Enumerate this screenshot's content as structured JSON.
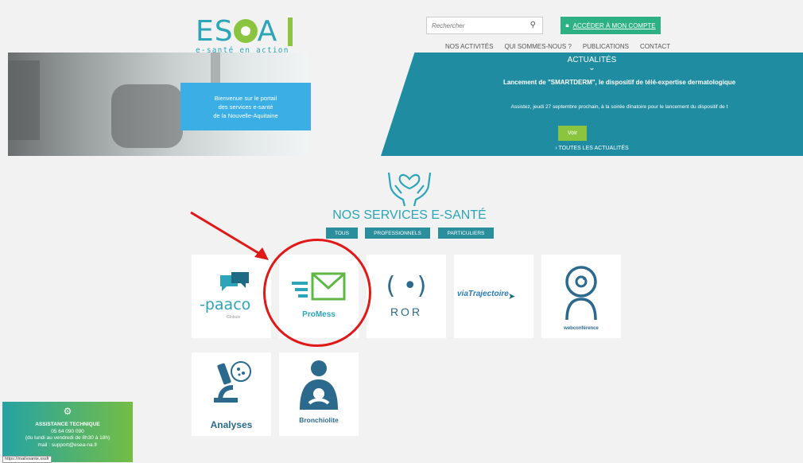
{
  "header": {
    "logo_text_left": "ES",
    "logo_text_right": "A",
    "logo_tagline": "e-santé en action",
    "search_placeholder": "Rechercher",
    "account_button": "ACCÉDER À MON COMPTE",
    "nav": [
      "NOS ACTIVITÉS",
      "QUI SOMMES-NOUS ?",
      "PUBLICATIONS",
      "CONTACT"
    ]
  },
  "hero": {
    "welcome_lines": [
      "Bienvenue sur le portail",
      "des services e-santé",
      "de la Nouvelle-Aquitaine"
    ],
    "news": {
      "section_title": "ACTUALITÉS",
      "headline": "Lancement de \"SMARTDERM\", le dispositif de télé-expertise dermatologique",
      "text": "Assistez, jeudi 27 septembre prochain, à la soirée dînatoire pour le lancement du dispositif de t",
      "voir_button": "Voir",
      "all_news_link": "TOUTES LES ACTUALITÉS"
    }
  },
  "services": {
    "title": "NOS SERVICES E-SANTÉ",
    "filters": [
      "TOUS",
      "PROFESSIONNELS",
      "PARTICULIERS"
    ],
    "cards": [
      {
        "name": "paaco",
        "label": "-paaco",
        "sublabel": "Globule"
      },
      {
        "name": "promess",
        "label": "ProMess"
      },
      {
        "name": "ror",
        "label": "ROR"
      },
      {
        "name": "viatrajectoire",
        "label": "viaTrajectoire"
      },
      {
        "name": "webconference",
        "label": "webconférence"
      },
      {
        "name": "analyses",
        "label": "Analyses"
      },
      {
        "name": "bronchiolite",
        "label": "Bronchiolite"
      }
    ]
  },
  "assistance": {
    "title": "ASSISTANCE TECHNIQUE",
    "phone": "05 64 090 090",
    "hours": "(du lundi au vendredi de 8h30 à 18h)",
    "mail": "mail : support@esea-na.fr"
  },
  "status_url": "https://mailvsante.sssfr",
  "colors": {
    "brand_teal": "#2ba5b7",
    "brand_green": "#8bc53f",
    "news_bg": "#1f8ca1",
    "welcome_blue": "#3aaee5",
    "annotation_red": "#e01818"
  }
}
